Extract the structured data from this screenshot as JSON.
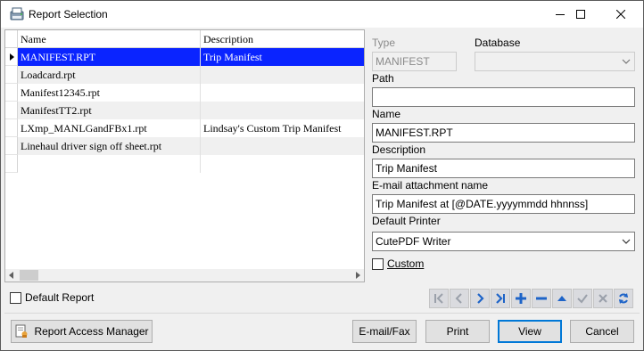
{
  "window": {
    "title": "Report Selection"
  },
  "grid": {
    "columns": [
      "Name",
      "Description"
    ],
    "rows": [
      {
        "name": "MANIFEST.RPT",
        "description": "Trip Manifest",
        "selected": true
      },
      {
        "name": "Loadcard.rpt",
        "description": ""
      },
      {
        "name": "Manifest12345.rpt",
        "description": ""
      },
      {
        "name": "ManifestTT2.rpt",
        "description": ""
      },
      {
        "name": "LXmp_MANLGandFBx1.rpt",
        "description": "Lindsay's Custom Trip Manifest"
      },
      {
        "name": "Linehaul driver sign off sheet.rpt",
        "description": ""
      },
      {
        "name": "",
        "description": ""
      }
    ]
  },
  "details": {
    "type_label": "Type",
    "type_value": "MANIFEST",
    "database_label": "Database",
    "database_value": "",
    "path_label": "Path",
    "path_value": "",
    "name_label": "Name",
    "name_value": "MANIFEST.RPT",
    "description_label": "Description",
    "description_value": "Trip Manifest",
    "email_label": "E-mail attachment name",
    "email_value": "Trip Manifest at [@DATE.yyyymmdd hhnnss]",
    "printer_label": "Default Printer",
    "printer_value": "CutePDF Writer",
    "custom_label": "Custom"
  },
  "default_report_label": "Default Report",
  "buttons": {
    "access_manager": "Report Access Manager",
    "email_fax": "E-mail/Fax",
    "print": "Print",
    "view": "View",
    "cancel": "Cancel"
  },
  "colors": {
    "selection": "#0a24ff",
    "nav_blue": "#1e64c8",
    "default_border": "#0078d7"
  }
}
